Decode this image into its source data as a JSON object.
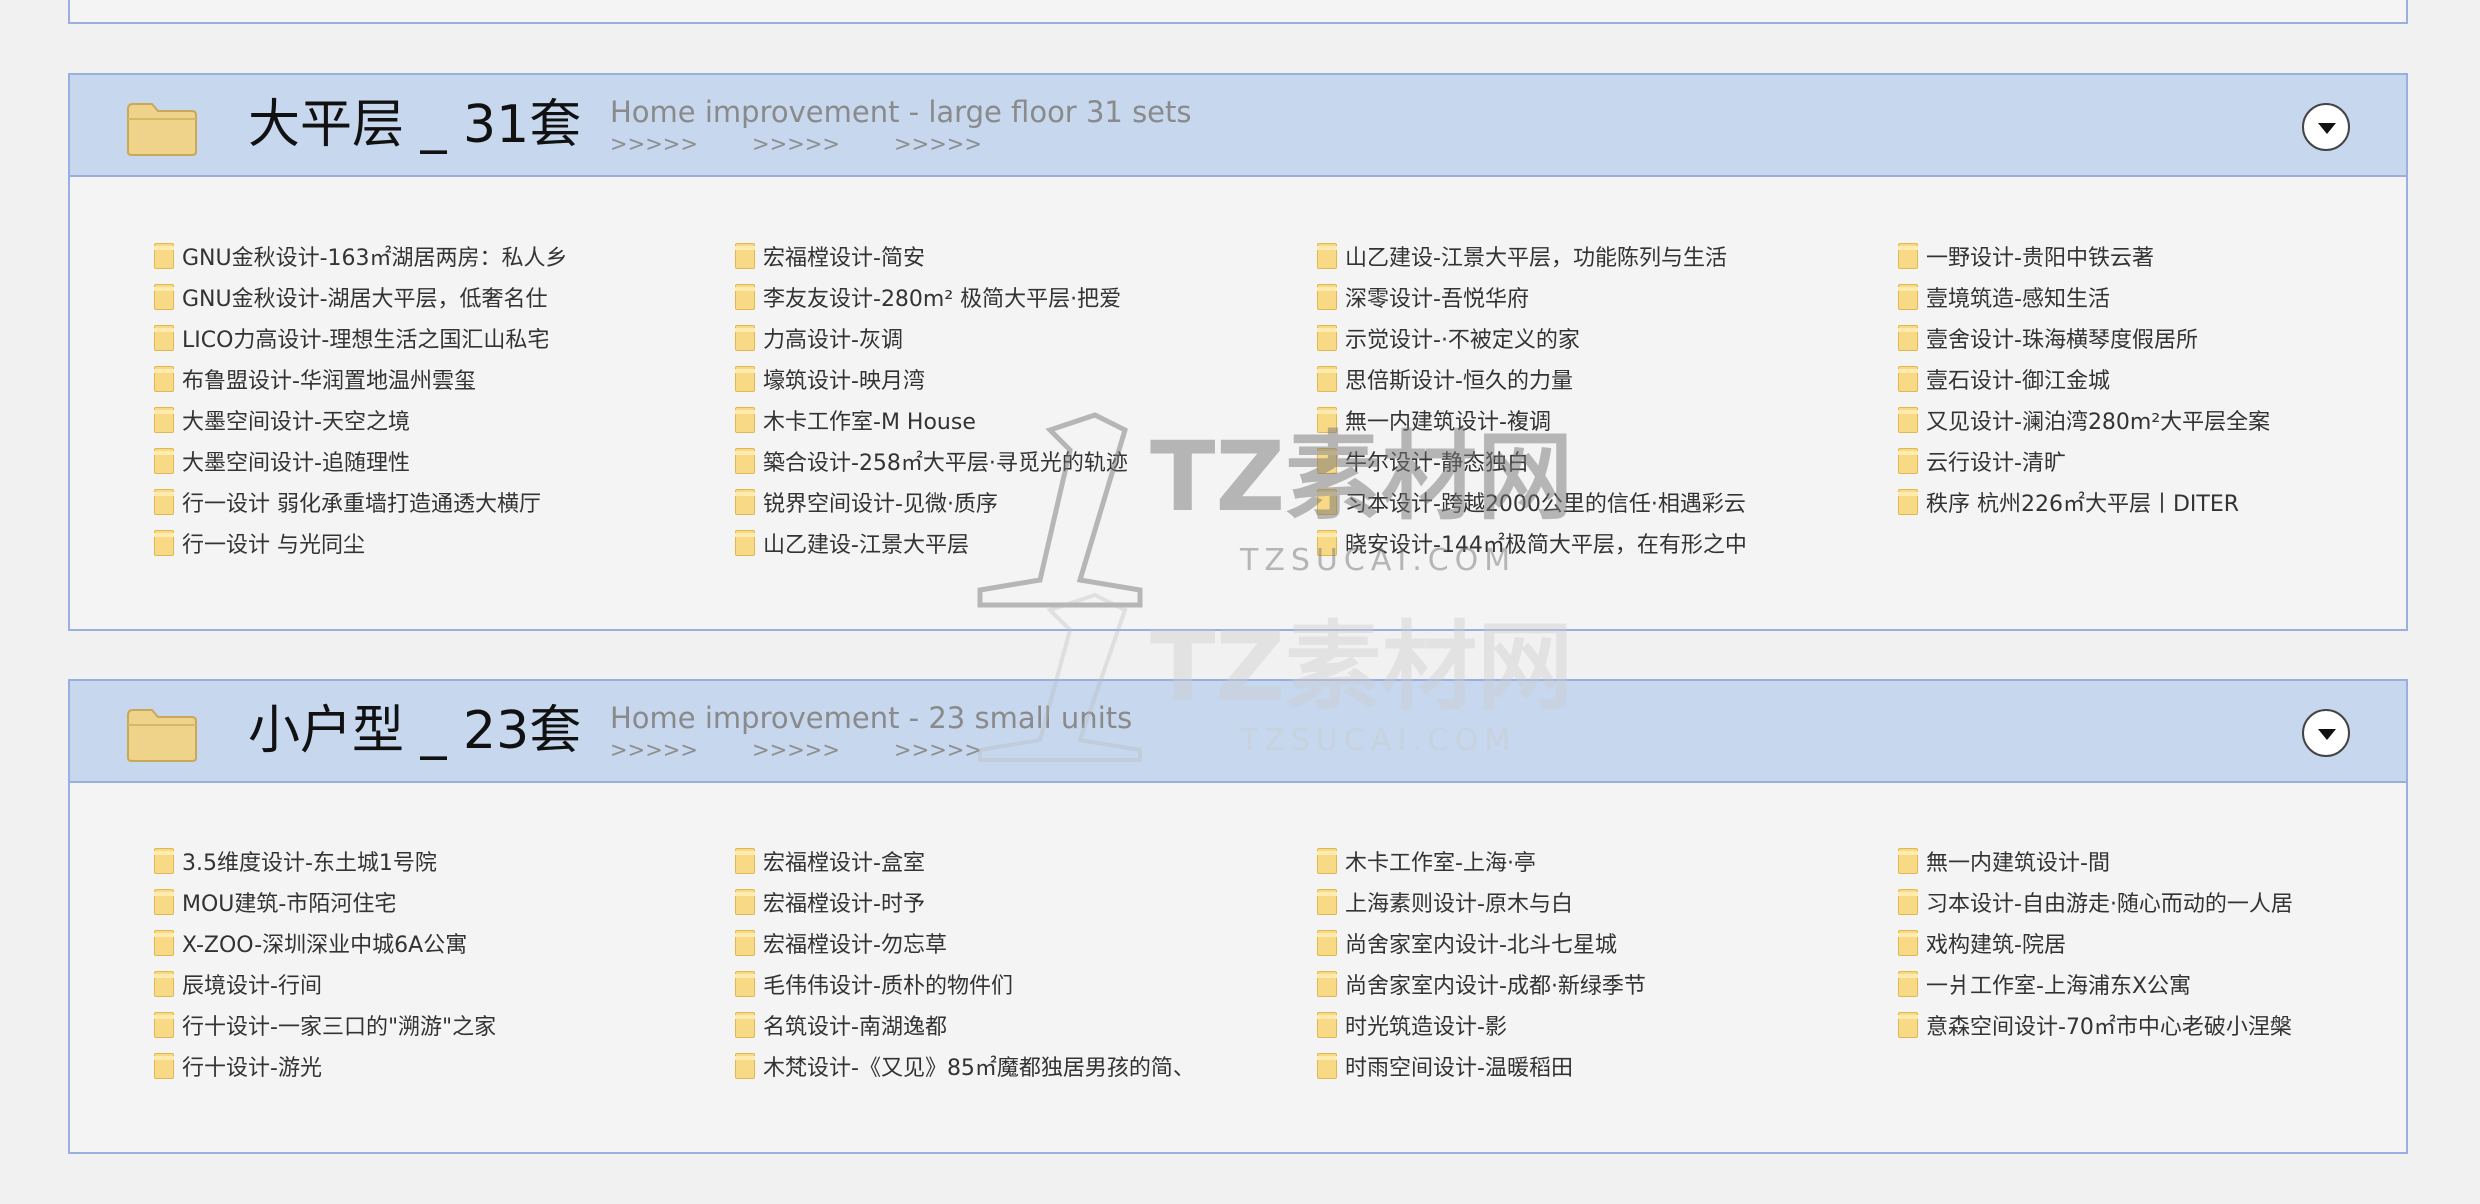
{
  "sections": [
    {
      "title": "大平层 _ 31套",
      "subtitle": "Home improvement - large floor 31 sets",
      "arrows": [
        ">>>>>",
        ">>>>>",
        ">>>>>"
      ],
      "columns": [
        [
          "GNU金秋设计-163㎡湖居两房：私人乡",
          "GNU金秋设计-湖居大平层，低奢名仕",
          "LICO力高设计-理想生活之国汇山私宅",
          "布鲁盟设计-华润置地温州雲玺",
          "大墨空间设计-天空之境",
          "大墨空间设计-追随理性",
          "行一设计 弱化承重墙打造通透大横厅",
          "行一设计 与光同尘"
        ],
        [
          "宏福樘设计-简安",
          "李友友设计-280m² 极简大平层·把爱",
          "力高设计-灰调",
          "壕筑设计-映月湾",
          "木卡工作室-M House",
          "築合设计-258㎡大平层·寻觅光的轨迹",
          "锐界空间设计-见微·质序",
          "山乙建设-江景大平层"
        ],
        [
          "山乙建设-江景大平层，功能陈列与生活",
          "深零设计-吾悦华府",
          "示觉设计-·不被定义的家",
          "思倍斯设计-恒久的力量",
          "無一内建筑设计-複调",
          "牛尔设计-静态独白",
          "习本设计-跨越2000公里的信任·相遇彩云",
          "晓安设计-144㎡极简大平层，在有形之中"
        ],
        [
          "一野设计-贵阳中铁云著",
          "壹境筑造-感知生活",
          "壹舍设计-珠海横琴度假居所",
          "壹石设计-御江金城",
          "又见设计-澜泊湾280m²大平层全案",
          "云行设计-清旷",
          "秩序 杭州226㎡大平层丨DITER"
        ]
      ]
    },
    {
      "title": "小户型 _ 23套",
      "subtitle": "Home improvement - 23 small units",
      "arrows": [
        ">>>>>",
        ">>>>>",
        ">>>>>"
      ],
      "columns": [
        [
          "3.5维度设计-东土城1号院",
          "MOU建筑-市陌河住宅",
          "X-ZOO-深圳深业中城6A公寓",
          "辰境设计-行间",
          "行十设计-一家三口的\"溯游\"之家",
          "行十设计-游光"
        ],
        [
          "宏福樘设计-盒室",
          "宏福樘设计-时予",
          "宏福樘设计-勿忘草",
          "毛伟伟设计-质朴的物件们",
          "名筑设计-南湖逸都",
          "木梵设计-《又见》85㎡魔都独居男孩的简、"
        ],
        [
          "木卡工作室-上海·亭",
          "上海素则设计-原木与白",
          "尚舍家室内设计-北斗七星城",
          "尚舍家室内设计-成都·新绿季节",
          "时光筑造设计-影",
          "时雨空间设计-温暖稻田"
        ],
        [
          "無一内建筑设计-間",
          "习本设计-自由游走·随心而动的一人居",
          "戏构建筑-院居",
          "一爿工作室-上海浦东X公寓",
          "意森空间设计-70㎡市中心老破小涅槃"
        ]
      ]
    }
  ],
  "watermark": {
    "brand": "TZ素材网",
    "domain": "TZSUCAI.COM"
  }
}
